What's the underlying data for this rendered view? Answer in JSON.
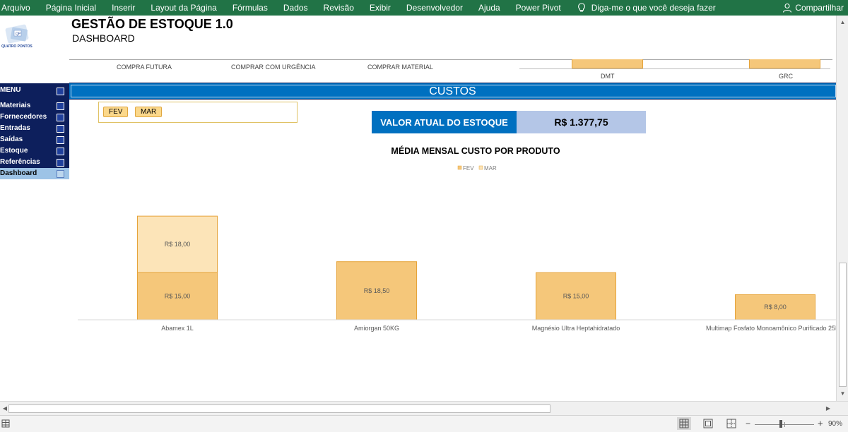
{
  "ribbon": {
    "tabs": [
      "Arquivo",
      "Página Inicial",
      "Inserir",
      "Layout da Página",
      "Fórmulas",
      "Dados",
      "Revisão",
      "Exibir",
      "Desenvolvedor",
      "Ajuda",
      "Power Pivot"
    ],
    "tell_me": "Diga-me o que você deseja fazer",
    "share": "Compartilhar",
    "tell_me_icon": "lightbulb-icon",
    "share_icon": "person-icon"
  },
  "header": {
    "title": "GESTÃO DE ESTOQUE 1.0",
    "subtitle": "DASHBOARD",
    "logo_text": "QUATRO PONTOS",
    "logo_colors": [
      "#9dc3e6",
      "#2a4d9c"
    ]
  },
  "top_nav": {
    "items": [
      "COMPRA FUTURA",
      "COMPRAR COM URGÊNCIA",
      "COMPRAR MATERIAL"
    ],
    "chart_labels": [
      "DMT",
      "GRC"
    ]
  },
  "sidebar": {
    "items": [
      {
        "label": "MENU"
      },
      {
        "label": "Materiais"
      },
      {
        "label": "Fornecedores"
      },
      {
        "label": "Entradas"
      },
      {
        "label": "Saídas"
      },
      {
        "label": "Estoque"
      },
      {
        "label": "Referências"
      },
      {
        "label": "Dashboard"
      }
    ],
    "active_index": 7
  },
  "section": {
    "title": "CUSTOS"
  },
  "slicer": {
    "buttons": [
      "FEV",
      "MAR"
    ]
  },
  "kpi": {
    "label": "VALOR ATUAL DO ESTOQUE",
    "value": "R$ 1.377,75"
  },
  "chart_data": {
    "type": "bar",
    "stacked": true,
    "title": "MÉDIA MENSAL CUSTO POR PRODUTO",
    "categories": [
      "Abamex 1L",
      "Amiorgan 50KG",
      "Magnésio Ultra Heptahidratado",
      "Multimap Fosfato Monoamônico Purificado 25KG"
    ],
    "series": [
      {
        "name": "FEV",
        "values": [
          15.0,
          18.5,
          15.0,
          8.0
        ],
        "labels": [
          "R$ 15,00",
          "R$ 18,50",
          "R$ 15,00",
          "R$ 8,00"
        ],
        "color": "#f5c77a"
      },
      {
        "name": "MAR",
        "values": [
          18.0,
          null,
          null,
          null
        ],
        "labels": [
          "R$ 18,00",
          "",
          "",
          ""
        ],
        "color": "#fce4b8"
      }
    ],
    "legend": "top",
    "grid": false
  },
  "statusbar": {
    "zoom": "90%",
    "zoom_minus": "−",
    "zoom_plus": "+"
  }
}
